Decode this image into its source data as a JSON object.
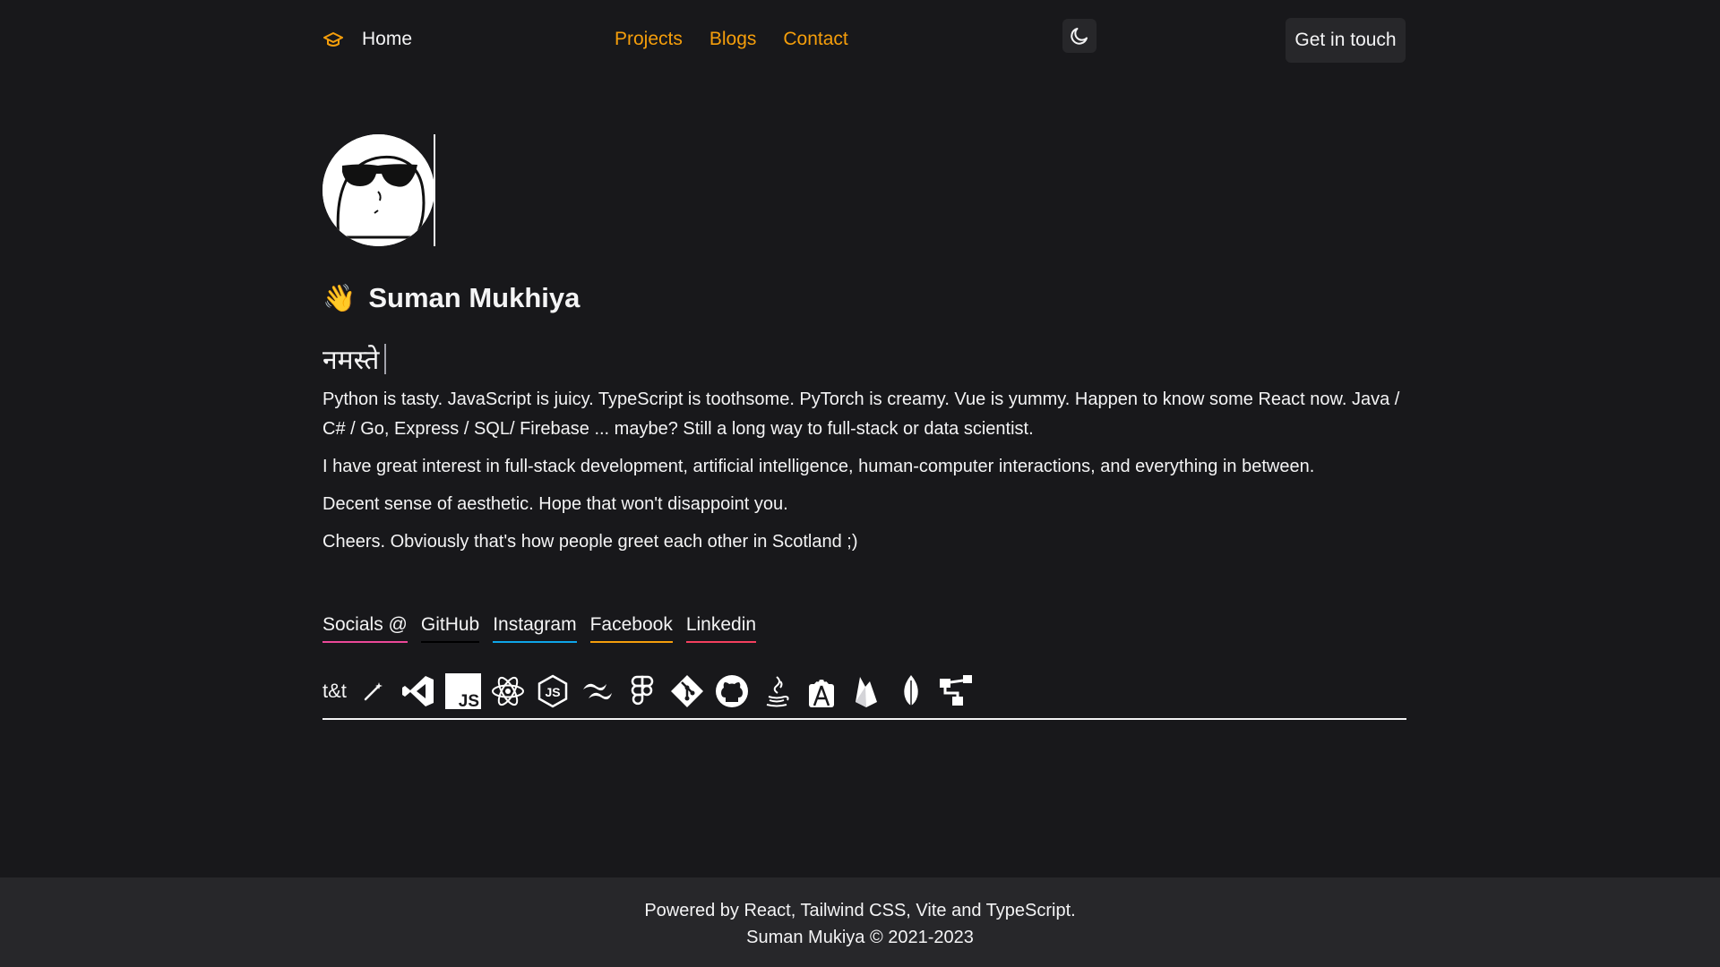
{
  "header": {
    "logo_icon": "graduation-cap-icon",
    "home_label": "Home",
    "nav": [
      "Projects",
      "Blogs",
      "Contact"
    ],
    "theme_icon": "moon-icon",
    "cta_label": "Get in touch",
    "accent_color": "#f59e0b"
  },
  "hero": {
    "avatar_icon": "sunglasses-avatar",
    "wave_emoji": "👋",
    "name": "Suman Mukhiya",
    "greeting": "नमस्ते"
  },
  "bio": [
    "Python is tasty. JavaScript is juicy. TypeScript is toothsome. PyTorch is creamy. Vue is yummy. Happen to know some React now. Java / C# / Go, Express / SQL/ Firebase ... maybe? Still a long way to full-stack or data scientist.",
    "I have great interest in full-stack development, artificial intelligence, human-computer interactions, and everything in between.",
    "Decent sense of aesthetic. Hope that won't disappoint you.",
    "Cheers. Obviously that's how people greet each other in Scotland ;)"
  ],
  "socials": {
    "label": "Socials @",
    "links": [
      "GitHub",
      "Instagram",
      "Facebook",
      "Linkedin"
    ]
  },
  "tools": {
    "label": "t&t",
    "icons": [
      "wand-icon",
      "vscode-icon",
      "javascript-icon",
      "react-icon",
      "nodejs-icon",
      "tailwind-icon",
      "figma-icon",
      "git-icon",
      "github-icon",
      "java-icon",
      "android-studio-icon",
      "firebase-icon",
      "mongodb-icon",
      "sitemap-icon"
    ]
  },
  "footer": {
    "line1": "Powered by React, Tailwind CSS, Vite and TypeScript.",
    "line2": "Suman Mukiya © 2021-2023"
  },
  "colors": {
    "background": "#18181b",
    "surface": "#27272a",
    "text": "#f4f4f5"
  }
}
